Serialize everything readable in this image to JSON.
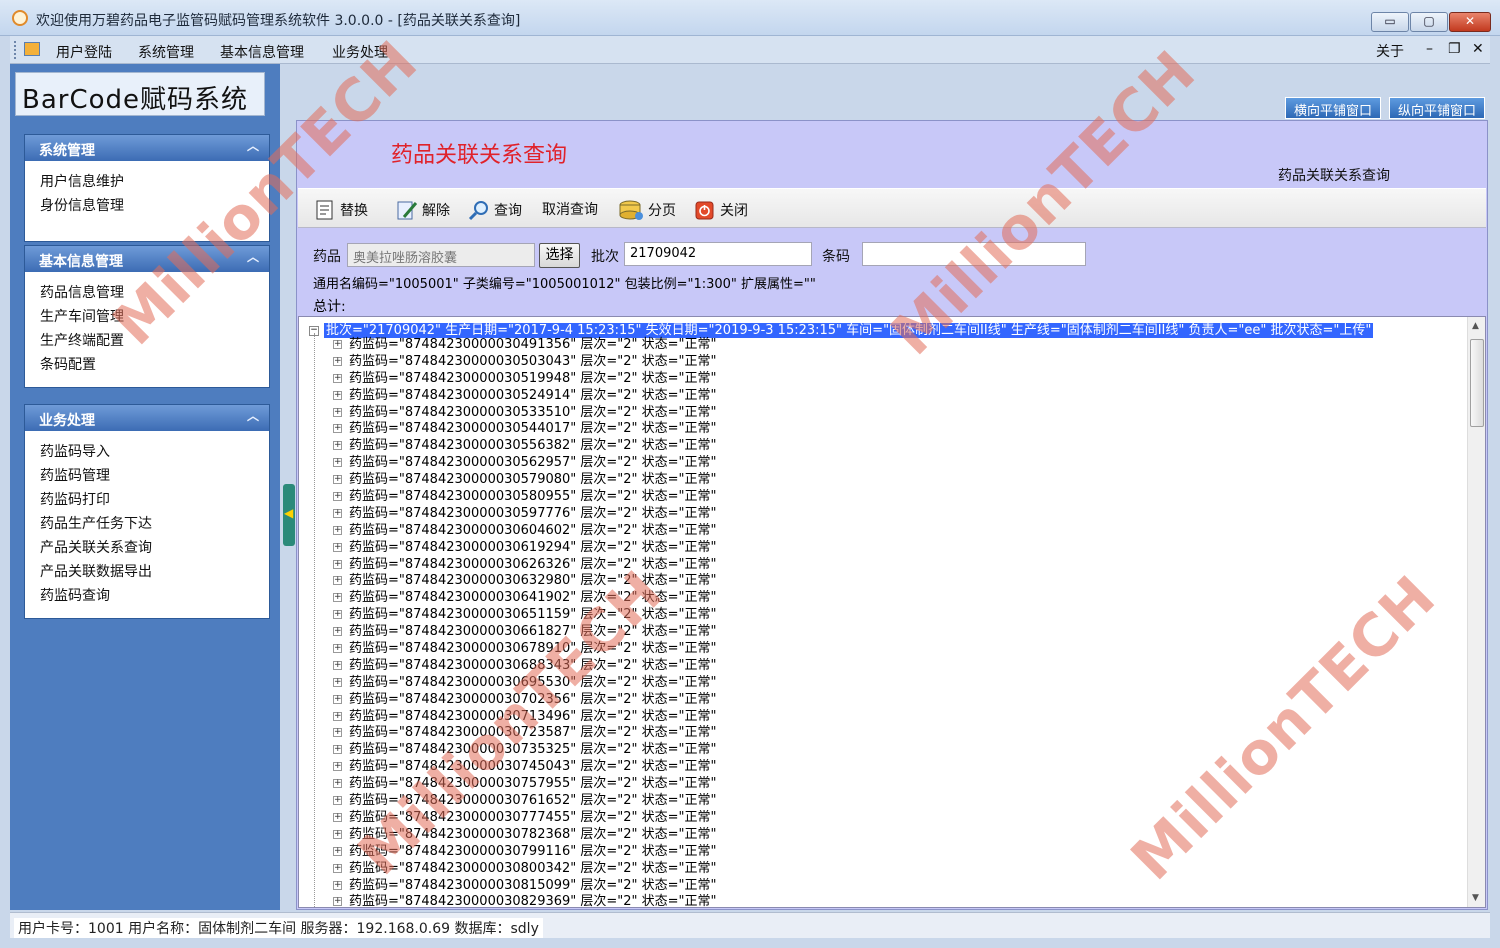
{
  "window": {
    "title": "欢迎使用万碧药品电子监管码赋码管理系统软件 3.0.0.0 - [药品关联关系查询]",
    "min": "▭",
    "max": "▢",
    "close": "✕"
  },
  "menu": {
    "items": [
      "用户登陆",
      "系统管理",
      "基本信息管理",
      "业务处理"
    ],
    "about": "关于",
    "mdi_min": "–",
    "mdi_restore": "❐",
    "mdi_close": "✕"
  },
  "brand": "BarCode赋码系统",
  "sidebar": {
    "groups": [
      {
        "title": "系统管理",
        "items": [
          "用户信息维护",
          "身份信息管理"
        ]
      },
      {
        "title": "基本信息管理",
        "items": [
          "药品信息管理",
          "生产车间管理",
          "生产终端配置",
          "条码配置"
        ]
      },
      {
        "title": "业务处理",
        "items": [
          "药监码导入",
          "药监码管理",
          "药监码打印",
          "药品生产任务下达",
          "产品关联关系查询",
          "产品关联数据导出",
          "药监码查询"
        ]
      }
    ],
    "chevron": "︿",
    "splitter_arrow": "◀"
  },
  "tile_buttons": [
    "横向平铺窗口",
    "纵向平铺窗口"
  ],
  "page": {
    "title": "药品关联关系查询",
    "title_right": "药品关联关系查询"
  },
  "toolbar": [
    "替换",
    "解除",
    "查询",
    "取消查询",
    "分页",
    "关闭"
  ],
  "form": {
    "drug_label": "药品",
    "drug_value": "奥美拉唑肠溶胶囊",
    "select_button": "选择",
    "batch_label": "批次",
    "batch_value": "21709042",
    "barcode_label": "条码",
    "barcode_value": "",
    "info_line": "通用名编码=\"1005001\" 子类编号=\"1005001012\" 包装比例=\"1:300\" 扩展属性=\"\"",
    "total_label": "总计:"
  },
  "tree": {
    "root": "批次=\"21709042\" 生产日期=\"2017-9-4 15:23:15\" 失效日期=\"2019-9-3 15:23:15\" 车间=\"固体制剂二车间II线\" 生产线=\"固体制剂二车间II线\" 负责人=\"ee\" 批次状态=\"上传\"",
    "root_toggle": "−",
    "child_toggle": "+",
    "rows": [
      "药监码=\"87484230000030491356\" 层次=\"2\" 状态=\"正常\"",
      "药监码=\"87484230000030503043\" 层次=\"2\" 状态=\"正常\"",
      "药监码=\"87484230000030519948\" 层次=\"2\" 状态=\"正常\"",
      "药监码=\"87484230000030524914\" 层次=\"2\" 状态=\"正常\"",
      "药监码=\"87484230000030533510\" 层次=\"2\" 状态=\"正常\"",
      "药监码=\"87484230000030544017\" 层次=\"2\" 状态=\"正常\"",
      "药监码=\"87484230000030556382\" 层次=\"2\" 状态=\"正常\"",
      "药监码=\"87484230000030562957\" 层次=\"2\" 状态=\"正常\"",
      "药监码=\"87484230000030579080\" 层次=\"2\" 状态=\"正常\"",
      "药监码=\"87484230000030580955\" 层次=\"2\" 状态=\"正常\"",
      "药监码=\"87484230000030597776\" 层次=\"2\" 状态=\"正常\"",
      "药监码=\"87484230000030604602\" 层次=\"2\" 状态=\"正常\"",
      "药监码=\"87484230000030619294\" 层次=\"2\" 状态=\"正常\"",
      "药监码=\"87484230000030626326\" 层次=\"2\" 状态=\"正常\"",
      "药监码=\"87484230000030632980\" 层次=\"2\" 状态=\"正常\"",
      "药监码=\"87484230000030641902\" 层次=\"2\" 状态=\"正常\"",
      "药监码=\"87484230000030651159\" 层次=\"2\" 状态=\"正常\"",
      "药监码=\"87484230000030661827\" 层次=\"2\" 状态=\"正常\"",
      "药监码=\"87484230000030678910\" 层次=\"2\" 状态=\"正常\"",
      "药监码=\"87484230000030688343\" 层次=\"2\" 状态=\"正常\"",
      "药监码=\"87484230000030695530\" 层次=\"2\" 状态=\"正常\"",
      "药监码=\"87484230000030702356\" 层次=\"2\" 状态=\"正常\"",
      "药监码=\"87484230000030713496\" 层次=\"2\" 状态=\"正常\"",
      "药监码=\"87484230000030723587\" 层次=\"2\" 状态=\"正常\"",
      "药监码=\"87484230000030735325\" 层次=\"2\" 状态=\"正常\"",
      "药监码=\"87484230000030745043\" 层次=\"2\" 状态=\"正常\"",
      "药监码=\"87484230000030757955\" 层次=\"2\" 状态=\"正常\"",
      "药监码=\"87484230000030761652\" 层次=\"2\" 状态=\"正常\"",
      "药监码=\"87484230000030777455\" 层次=\"2\" 状态=\"正常\"",
      "药监码=\"87484230000030782368\" 层次=\"2\" 状态=\"正常\"",
      "药监码=\"87484230000030799116\" 层次=\"2\" 状态=\"正常\"",
      "药监码=\"87484230000030800342\" 层次=\"2\" 状态=\"正常\"",
      "药监码=\"87484230000030815099\" 层次=\"2\" 状态=\"正常\"",
      "药监码=\"87484230000030829369\" 层次=\"2\" 状态=\"正常\""
    ]
  },
  "statusbar": "用户卡号：1001  用户名称：固体制剂二车间  服务器：192.168.0.69  数据库：sdly",
  "watermark": "MillionTECH",
  "colors": {
    "page_title": "#e0222a",
    "content_bg": "#c8c8f8",
    "sidebar_bg": "#4e7dbf",
    "selection": "#3366ff"
  }
}
